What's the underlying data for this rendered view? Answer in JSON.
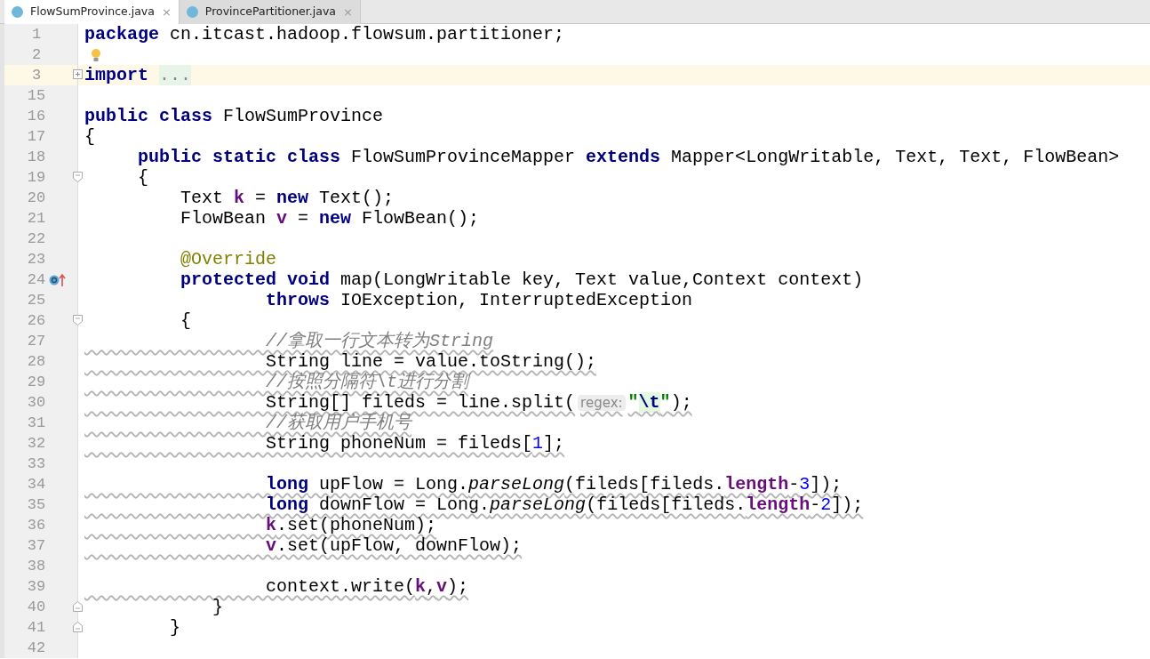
{
  "tabs": [
    {
      "label": "FlowSumProvince.java",
      "selected": true,
      "close": "×"
    },
    {
      "label": "ProvincePartitioner.java",
      "selected": false,
      "close": "×"
    }
  ],
  "lines": [
    {
      "number": "1",
      "tokens": [
        {
          "kind": "kw",
          "text": "package"
        },
        {
          "kind": "plain",
          "text": " cn.itcast.hadoop.flowsum.partitioner;"
        }
      ]
    },
    {
      "number": "2",
      "marker": {
        "kind": "bulb"
      }
    },
    {
      "number": "3",
      "current": true,
      "fold": {
        "kind": "expand"
      },
      "tokens": [
        {
          "kind": "kw",
          "text": "import "
        },
        {
          "kind": "folded",
          "text": "..."
        }
      ]
    },
    {
      "number": "15"
    },
    {
      "number": "16",
      "tokens": [
        {
          "kind": "kw",
          "text": "public class"
        },
        {
          "kind": "plain",
          "text": " FlowSumProvince"
        }
      ]
    },
    {
      "number": "17",
      "tokens": [
        {
          "kind": "plain",
          "text": "{"
        }
      ]
    },
    {
      "number": "18",
      "tokens": [
        {
          "kind": "kw",
          "text": "     public static class"
        },
        {
          "kind": "plain",
          "text": " FlowSumProvinceMapper "
        },
        {
          "kind": "kw",
          "text": "extends"
        },
        {
          "kind": "plain",
          "text": " Mapper<LongWritable, Text, Text, FlowBean>"
        }
      ]
    },
    {
      "number": "19",
      "fold": {
        "kind": "start"
      },
      "tokens": [
        {
          "kind": "plain",
          "text": "     {"
        }
      ]
    },
    {
      "number": "20",
      "tokens": [
        {
          "kind": "plain",
          "text": "         Text "
        },
        {
          "kind": "field",
          "text": "k"
        },
        {
          "kind": "plain",
          "text": " = "
        },
        {
          "kind": "kw",
          "text": "new"
        },
        {
          "kind": "plain",
          "text": " Text();"
        }
      ]
    },
    {
      "number": "21",
      "tokens": [
        {
          "kind": "plain",
          "text": "         FlowBean "
        },
        {
          "kind": "field",
          "text": "v"
        },
        {
          "kind": "plain",
          "text": " = "
        },
        {
          "kind": "kw",
          "text": "new"
        },
        {
          "kind": "plain",
          "text": " FlowBean();"
        }
      ]
    },
    {
      "number": "22"
    },
    {
      "number": "23",
      "tokens": [
        {
          "kind": "ann",
          "text": "         @Override"
        }
      ]
    },
    {
      "number": "24",
      "marker": {
        "kind": "override"
      },
      "tokens": [
        {
          "kind": "kw",
          "text": "         protected void"
        },
        {
          "kind": "plain",
          "text": " map(LongWritable key, Text value,Context context)"
        }
      ]
    },
    {
      "number": "25",
      "tokens": [
        {
          "kind": "kw",
          "text": "                 throws"
        },
        {
          "kind": "plain",
          "text": " IOException, InterruptedException"
        }
      ]
    },
    {
      "number": "26",
      "fold": {
        "kind": "start"
      },
      "tokens": [
        {
          "kind": "plain",
          "text": "         {"
        }
      ]
    },
    {
      "number": "27",
      "underlined": true,
      "tokens": [
        {
          "kind": "comment",
          "text": "                 //拿取一行文本转为String"
        }
      ]
    },
    {
      "number": "28",
      "underlined": true,
      "tokens": [
        {
          "kind": "plain",
          "text": "                 String line = value.toString();"
        }
      ]
    },
    {
      "number": "29",
      "underlined": true,
      "tokens": [
        {
          "kind": "comment",
          "text": "                 //按照分隔符\\t进行分割"
        }
      ]
    },
    {
      "number": "30",
      "underlined": true,
      "tokens": [
        {
          "kind": "plain",
          "text": "                 String[] fileds = line.split("
        },
        {
          "kind": "hint",
          "text": "regex:"
        },
        {
          "kind": "str",
          "text": "\""
        },
        {
          "kind": "escape",
          "text": "\\t"
        },
        {
          "kind": "str",
          "text": "\""
        },
        {
          "kind": "plain",
          "text": ");"
        }
      ]
    },
    {
      "number": "31",
      "underlined": true,
      "tokens": [
        {
          "kind": "comment",
          "text": "                 //获取用户手机号"
        }
      ]
    },
    {
      "number": "32",
      "underlined": true,
      "tokens": [
        {
          "kind": "plain",
          "text": "                 String phoneNum = fileds["
        },
        {
          "kind": "num",
          "text": "1"
        },
        {
          "kind": "plain",
          "text": "];"
        }
      ]
    },
    {
      "number": "33"
    },
    {
      "number": "34",
      "underlined": true,
      "tokens": [
        {
          "kind": "kw",
          "text": "                 long"
        },
        {
          "kind": "plain",
          "text": " upFlow = Long."
        },
        {
          "kind": "static",
          "text": "parseLong"
        },
        {
          "kind": "plain",
          "text": "(fileds[fileds."
        },
        {
          "kind": "field",
          "text": "length"
        },
        {
          "kind": "plain",
          "text": "-"
        },
        {
          "kind": "num",
          "text": "3"
        },
        {
          "kind": "plain",
          "text": "]);"
        }
      ]
    },
    {
      "number": "35",
      "underlined": true,
      "tokens": [
        {
          "kind": "kw",
          "text": "                 long"
        },
        {
          "kind": "plain",
          "text": " downFlow = Long."
        },
        {
          "kind": "static",
          "text": "parseLong"
        },
        {
          "kind": "plain",
          "text": "(fileds[fileds."
        },
        {
          "kind": "field",
          "text": "length"
        },
        {
          "kind": "plain",
          "text": "-"
        },
        {
          "kind": "num",
          "text": "2"
        },
        {
          "kind": "plain",
          "text": "]);"
        }
      ]
    },
    {
      "number": "36",
      "underlined": true,
      "tokens": [
        {
          "kind": "field",
          "text": "                 k"
        },
        {
          "kind": "plain",
          "text": ".set(phoneNum);"
        }
      ]
    },
    {
      "number": "37",
      "underlined": true,
      "tokens": [
        {
          "kind": "field",
          "text": "                 v"
        },
        {
          "kind": "plain",
          "text": ".set(upFlow, downFlow);"
        }
      ]
    },
    {
      "number": "38"
    },
    {
      "number": "39",
      "underlined": true,
      "tokens": [
        {
          "kind": "plain",
          "text": "                 context.write("
        },
        {
          "kind": "field",
          "text": "k"
        },
        {
          "kind": "plain",
          "text": ","
        },
        {
          "kind": "field",
          "text": "v"
        },
        {
          "kind": "plain",
          "text": ");"
        }
      ]
    },
    {
      "number": "40",
      "fold": {
        "kind": "end"
      },
      "tokens": [
        {
          "kind": "plain",
          "text": "            }"
        }
      ]
    },
    {
      "number": "41",
      "fold": {
        "kind": "end"
      },
      "tokens": [
        {
          "kind": "plain",
          "text": "        }"
        }
      ]
    },
    {
      "number": "42"
    }
  ]
}
